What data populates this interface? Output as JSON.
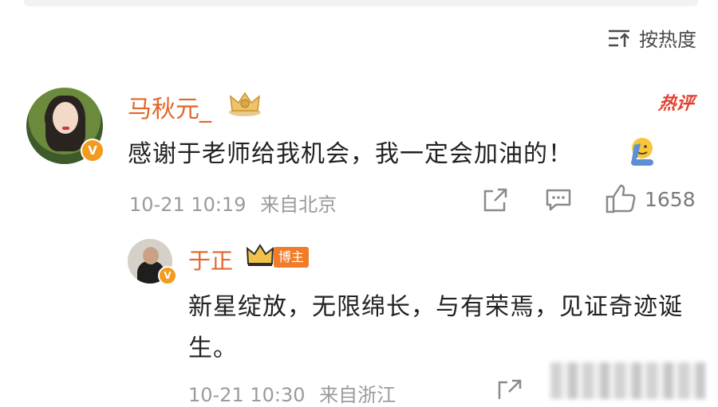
{
  "sort": {
    "label": "按热度",
    "icon": "sort-icon"
  },
  "main_comment": {
    "username": "马秋元_",
    "badge_icon": "crown-badge-icon",
    "hot_tag": "热评",
    "text": "感谢于老师给我机会，我一定会加油的！",
    "emoji": "salute-emoji-icon",
    "time": "10-21 10:19",
    "location": "来自北京",
    "like_count": "1658",
    "verified": "V",
    "accent": "#e2662b"
  },
  "reply": {
    "username": "于正",
    "badge_icon": "crown-badge-icon",
    "owner_label": "博主",
    "text": "新星绽放，无限绵长，与有荣焉，见证奇迹诞生。",
    "time": "10-21 10:30",
    "location": "来自浙江",
    "verified": "V"
  }
}
